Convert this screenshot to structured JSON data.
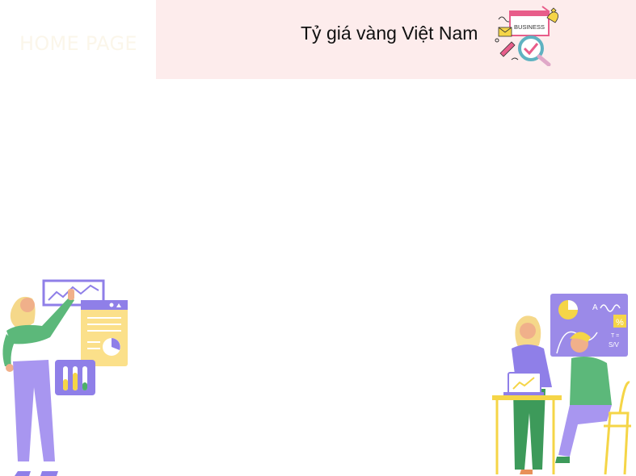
{
  "nav": {
    "home_label": "HOME PAGE"
  },
  "header": {
    "title": "Tỷ giá vàng Việt Nam",
    "background": "#fdecec",
    "badge_text": "BUSINESS",
    "badge_icon": "business-checkmark-icon"
  },
  "illustrations": {
    "left": "woman-presenting-dashboard-illustration",
    "right": "team-meeting-illustration",
    "right_board_text": [
      "%",
      "T =",
      "S/V"
    ]
  }
}
